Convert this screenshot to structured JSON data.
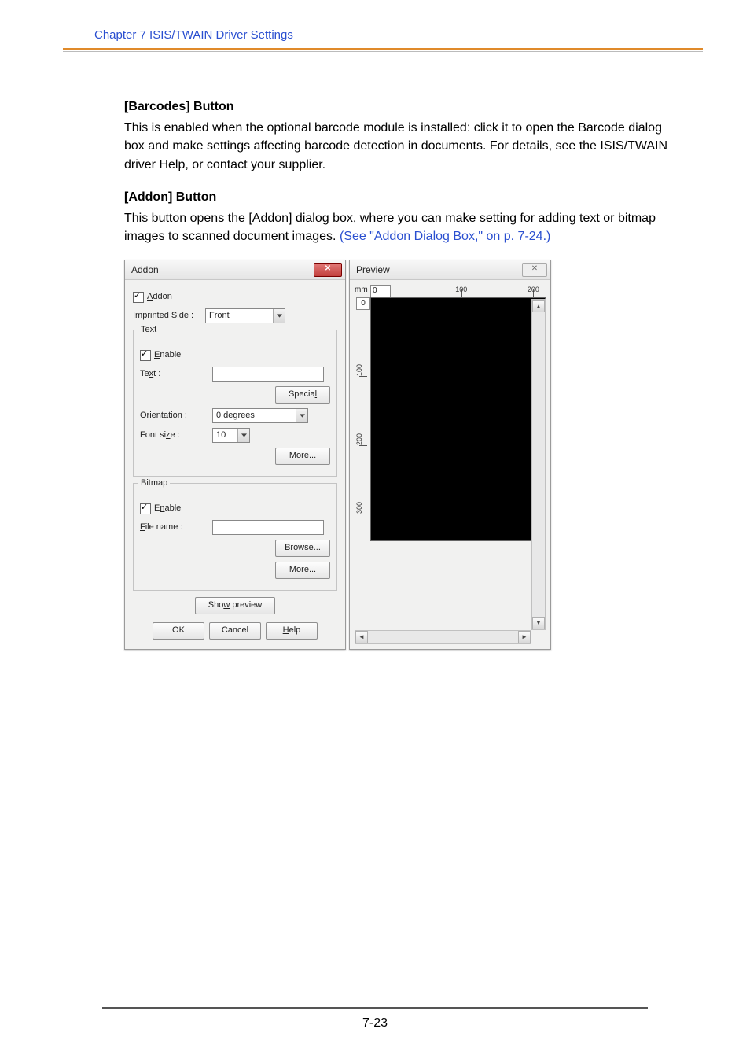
{
  "chapter_head": "Chapter 7   ISIS/TWAIN Driver Settings",
  "sections": {
    "barcodes": {
      "title": "[Barcodes] Button",
      "body": "This is enabled when the optional barcode module is installed: click it to open the Barcode dialog box and make settings affecting barcode detection in documents. For details, see the ISIS/TWAIN driver Help, or contact your supplier."
    },
    "addon": {
      "title": "[Addon] Button",
      "body": "This button opens the [Addon] dialog box, where you can make setting for adding text or bitmap images to scanned document images. ",
      "body_link": "(See \"Addon Dialog Box,\" on p. 7-24.)"
    }
  },
  "dialog": {
    "title": "Addon",
    "addon_chk": "Addon",
    "imprinted_side_lbl": "Imprinted Side :",
    "imprinted_side_val": "Front",
    "text_group": "Text",
    "enable_lbl": "Enable",
    "text_lbl": "Text :",
    "special_btn": "Special",
    "orientation_lbl": "Orientation :",
    "orientation_val": "0 degrees",
    "font_size_lbl": "Font size :",
    "font_size_val": "10",
    "more_btn": "More...",
    "bitmap_group": "Bitmap",
    "file_name_lbl": "File name :",
    "browse_btn": "Browse...",
    "show_preview_btn": "Show preview",
    "ok_btn": "OK",
    "cancel_btn": "Cancel",
    "help_btn": "Help"
  },
  "preview": {
    "title": "Preview",
    "mm_unit": "mm",
    "h_start": "0",
    "h_marks": [
      "100",
      "200"
    ],
    "v_start": "0",
    "v_marks": [
      "100",
      "200",
      "300"
    ]
  },
  "page_number": "7-23"
}
